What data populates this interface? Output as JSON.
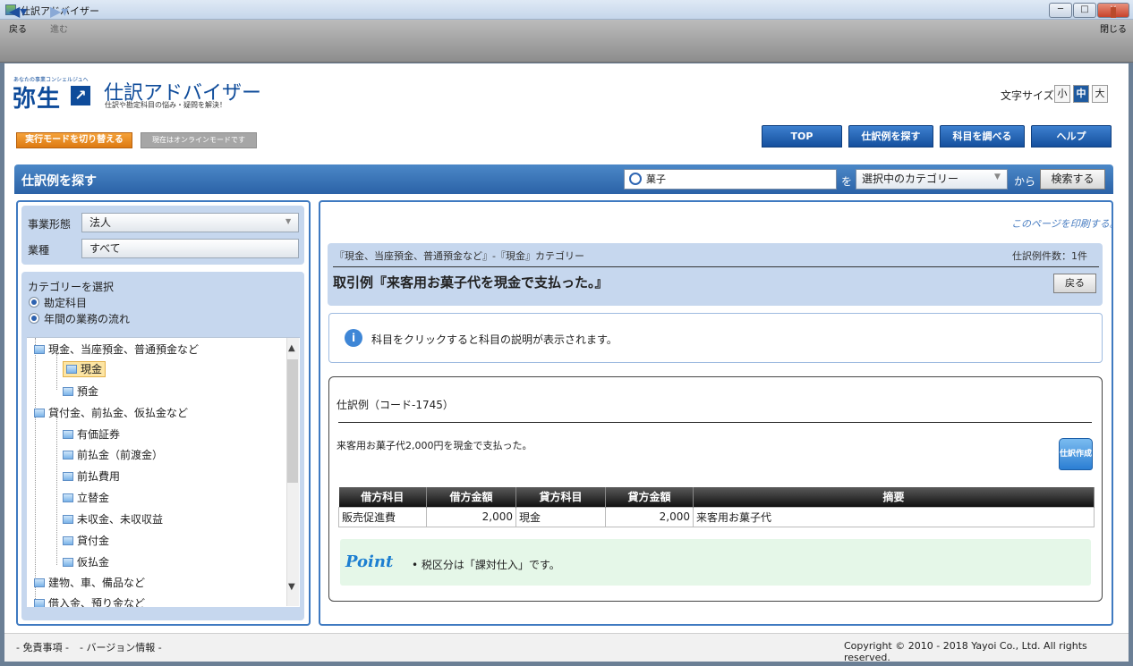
{
  "window": {
    "title": "仕訳アドバイザー",
    "min": "─",
    "max": "□",
    "close": "✕"
  },
  "nav": {
    "back": "戻る",
    "forward": "進む",
    "close": "閉じる"
  },
  "header": {
    "brand": "弥生",
    "brand_tagline": "あなたの事業コンシェルジュへ",
    "app_title": "仕訳アドバイザー",
    "app_subtitle": "仕訳や勘定科目の悩み・疑問を解決！",
    "font_size_label": "文字サイズ",
    "font_sizes": [
      "小",
      "中",
      "大"
    ],
    "mode_switch": "実行モードを切り替える",
    "mode_status": "現在はオンラインモードです",
    "menu": [
      "TOP",
      "仕訳例を探す",
      "科目を調べる",
      "ヘルプ"
    ]
  },
  "search": {
    "title": "仕訳例を探す",
    "query": "菓子",
    "wo": "を",
    "category": "選択中のカテゴリー",
    "kara": "から",
    "button": "検索する"
  },
  "sidebar": {
    "business_type_label": "事業形態",
    "business_type_value": "法人",
    "industry_label": "業種",
    "industry_value": "すべて",
    "category_header": "カテゴリーを選択",
    "radio_account": "勘定科目",
    "radio_flow": "年間の業務の流れ",
    "tree": [
      "現金、当座預金、普通預金など",
      "現金",
      "預金",
      "貸付金、前払金、仮払金など",
      "有価証券",
      "前払金（前渡金）",
      "前払費用",
      "立替金",
      "未収金、未収収益",
      "貸付金",
      "仮払金",
      "建物、車、備品など",
      "借入金、預り金など"
    ]
  },
  "main": {
    "print_link": "このページを印刷する。",
    "category_path": "『現金、当座預金、普通預金など』-『現金』カテゴリー",
    "count": "仕訳例件数：1件",
    "example_title": "取引例『来客用お菓子代を現金で支払った。』",
    "back_button": "戻る",
    "info_text": "科目をクリックすると科目の説明が表示されます。",
    "code_label": "仕訳例（コード-1745）",
    "description": "来客用お菓子代2,000円を現金で支払った。",
    "create_label": "仕訳作成",
    "table_headers": [
      "借方科目",
      "借方金額",
      "貸方科目",
      "貸方金額",
      "摘要"
    ],
    "table_row": [
      "販売促進費",
      "2,000",
      "現金",
      "2,000",
      "来客用お菓子代"
    ],
    "point_label": "Point",
    "point_text": "• 税区分は「課対仕入」です。"
  },
  "footer": {
    "disclaimer": "- 免責事項 -",
    "version": "- バージョン情報 -",
    "copyright": "Copyright © 2010 - 2018 Yayoi Co., Ltd. All rights reserved."
  }
}
